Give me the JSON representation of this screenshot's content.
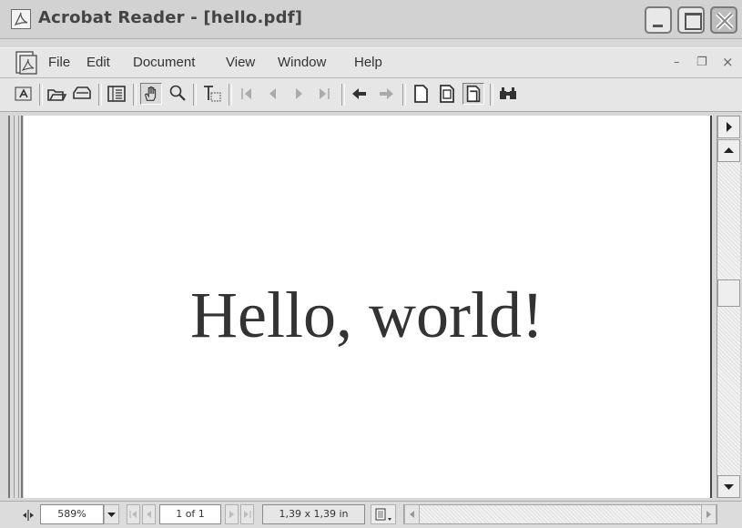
{
  "window": {
    "title": "Acrobat Reader - [hello.pdf]"
  },
  "menu": {
    "items": [
      "File",
      "Edit",
      "Document",
      "View",
      "Window",
      "Help"
    ],
    "mdi_minimize": "–",
    "mdi_restore": "❐",
    "mdi_close": "×"
  },
  "toolbar": {
    "buttons": [
      "text-select-icon",
      "open-icon",
      "print-icon",
      "bookmarks-pane-icon",
      "hand-tool-icon",
      "zoom-tool-icon",
      "text-tool-icon",
      "first-page-icon",
      "previous-page-icon",
      "next-page-icon",
      "last-page-icon",
      "go-back-icon",
      "go-forward-icon",
      "actual-size-icon",
      "fit-page-icon",
      "fit-width-icon",
      "find-icon"
    ],
    "active": [
      "hand-tool-icon",
      "fit-width-icon"
    ]
  },
  "document": {
    "text": "Hello, world!"
  },
  "status": {
    "zoom": "589%",
    "page": "1 of 1",
    "page_size": "1,39 x 1,39 in"
  }
}
